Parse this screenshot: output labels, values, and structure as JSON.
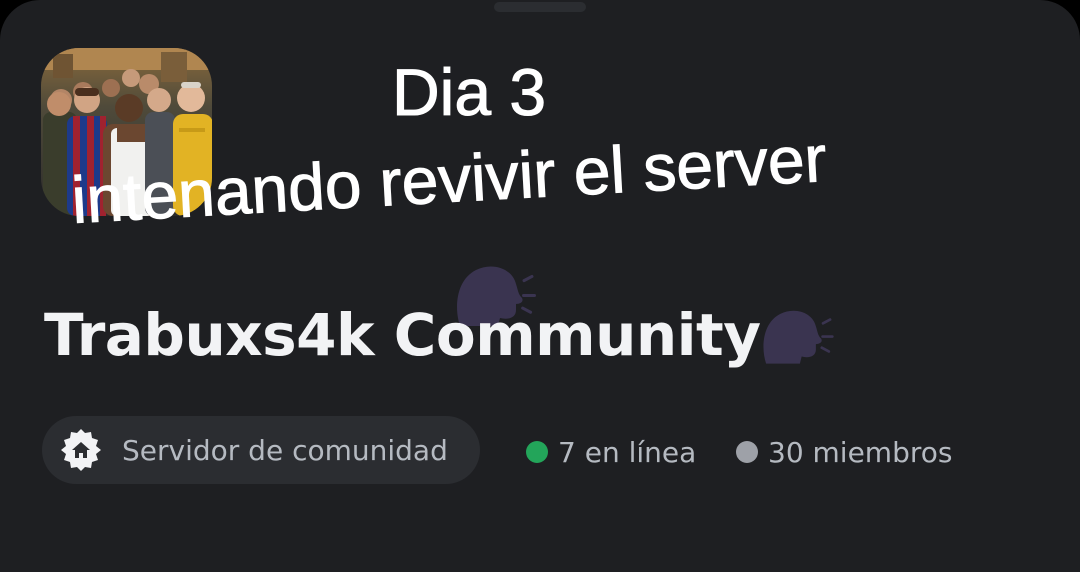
{
  "overlay": {
    "line1": "Dia 3",
    "line2": "intenando revivir el server"
  },
  "server": {
    "name": "Trabuxs4k Community",
    "name_emoji": "speaking-head-emoji",
    "icon": "server-avatar-image"
  },
  "badge": {
    "icon": "home-icon",
    "label": "Servidor de comunidad"
  },
  "stats": {
    "online": "7 en línea",
    "members": "30 miembros"
  },
  "colors": {
    "background": "#1e1f22",
    "pill": "#2b2d31",
    "text_primary": "#f2f3f5",
    "text_secondary": "#b5bac1",
    "online_dot": "#23a55a",
    "members_dot": "#9ea1a8",
    "emoji": "#3a3450"
  }
}
